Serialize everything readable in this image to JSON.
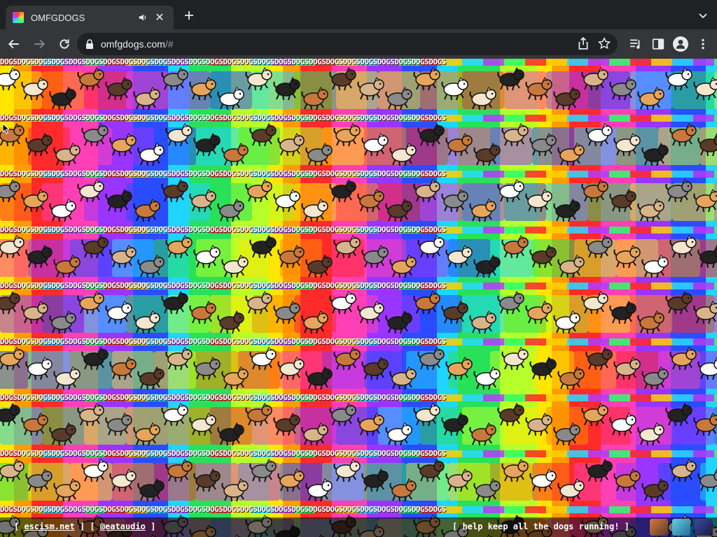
{
  "browser": {
    "tab": {
      "title": "OMFGDOGS",
      "audio_icon": "speaker-icon",
      "close_icon": "close-icon"
    },
    "new_tab_icon": "plus-icon",
    "address": {
      "host": "omfgdogs.com",
      "path": "/#"
    },
    "icons": [
      "back-icon",
      "forward-icon",
      "reload-icon",
      "lock-icon",
      "share-icon",
      "star-icon",
      "media-icon",
      "side-panel-icon",
      "profile-icon",
      "menu-icon",
      "tab-search-icon"
    ]
  },
  "page": {
    "banner_word": "DOGSDOGSDOGSDOGSDOGSDOGSDOGSDOGSDOGSDOGSDOGSDOGSDOGSDOGSDOGSDOGSDOGSDOGSDOGSDOGSDOGSDOGSDOGSDOGSDOGSDOGS"
  },
  "footer": {
    "open1": "[ ",
    "link1": "escism.net",
    "mid": " ] [ ",
    "link2": "@eataudio",
    "close1": " ]",
    "right_text": "[ help keep all the dogs running! ]"
  },
  "colors": {
    "chrome_dark": "#202124",
    "chrome_toolbar": "#35363a",
    "text_light": "#e8eaed"
  }
}
